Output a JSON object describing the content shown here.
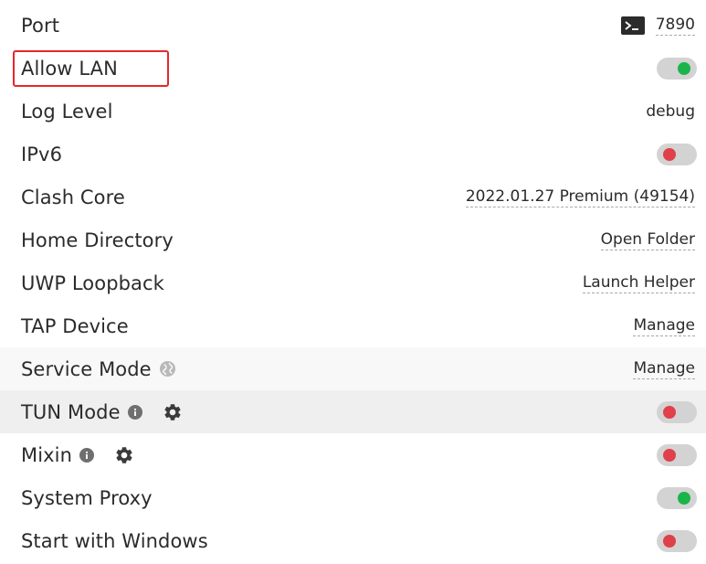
{
  "settings": {
    "port": {
      "label": "Port",
      "value": "7890",
      "icon": "terminal-icon"
    },
    "allow_lan": {
      "label": "Allow LAN",
      "enabled": true
    },
    "log_level": {
      "label": "Log Level",
      "value": "debug"
    },
    "ipv6": {
      "label": "IPv6",
      "enabled": false
    },
    "clash_core": {
      "label": "Clash Core",
      "value": "2022.01.27 Premium (49154)"
    },
    "home_directory": {
      "label": "Home Directory",
      "value": "Open Folder"
    },
    "uwp_loopback": {
      "label": "UWP Loopback",
      "value": "Launch Helper"
    },
    "tap_device": {
      "label": "TAP Device",
      "value": "Manage"
    },
    "service_mode": {
      "label": "Service Mode",
      "value": "Manage",
      "icon": "globe-icon"
    },
    "tun_mode": {
      "label": "TUN Mode",
      "enabled": false,
      "icons": [
        "info-icon",
        "gear-icon"
      ]
    },
    "mixin": {
      "label": "Mixin",
      "enabled": false,
      "icons": [
        "info-icon",
        "gear-icon"
      ]
    },
    "system_proxy": {
      "label": "System Proxy",
      "enabled": true
    },
    "start_with_windows": {
      "label": "Start with Windows",
      "enabled": false
    }
  },
  "colors": {
    "toggle_track": "#d3d3d3",
    "toggle_on": "#1bb44a",
    "toggle_off": "#e0404a",
    "highlight": "#e8262a"
  }
}
